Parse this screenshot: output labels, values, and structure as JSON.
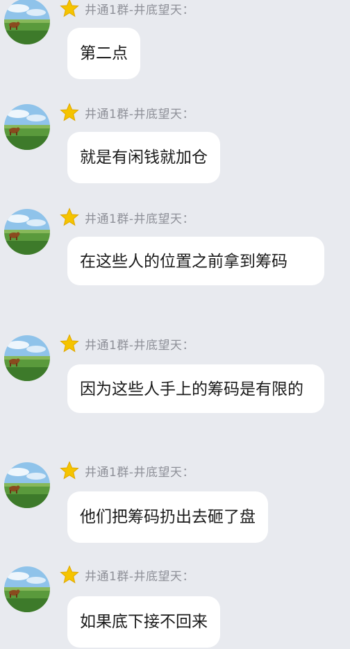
{
  "chat": {
    "sender_name": "井通1群-井底望天：",
    "star_icon": "star-icon",
    "avatar_icon": "avatar-landscape-cow",
    "colors": {
      "background": "#e8eaef",
      "bubble": "#ffffff",
      "name": "#8e9098",
      "text": "#1a1a1a",
      "star": "#f5c400"
    },
    "messages": [
      {
        "sender": "井通1群-井底望天：",
        "text": "第二点"
      },
      {
        "sender": "井通1群-井底望天：",
        "text": "就是有闲钱就加仓"
      },
      {
        "sender": "井通1群-井底望天：",
        "text": "在这些人的位置之前拿到筹码"
      },
      {
        "sender": "井通1群-井底望天：",
        "text": "因为这些人手上的筹码是有限的"
      },
      {
        "sender": "井通1群-井底望天：",
        "text": "他们把筹码扔出去砸了盘"
      },
      {
        "sender": "井通1群-井底望天：",
        "text": "如果底下接不回来"
      }
    ]
  }
}
